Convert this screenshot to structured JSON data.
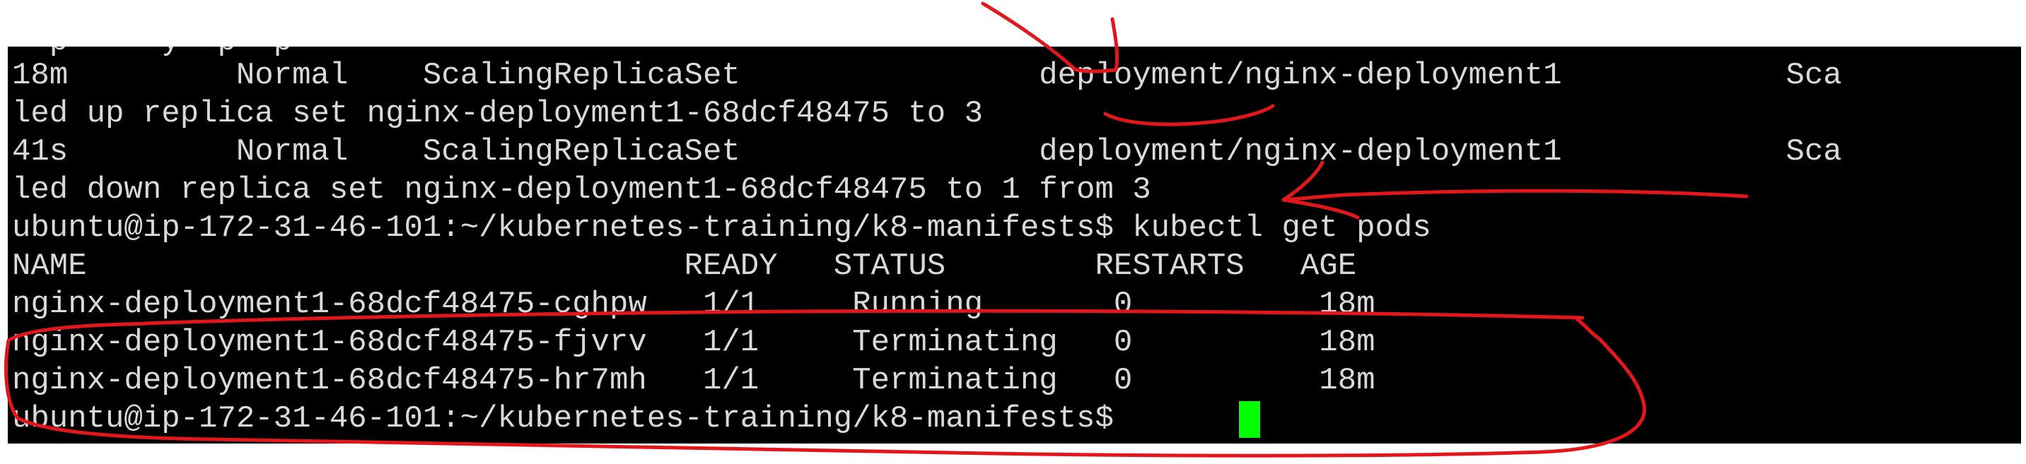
{
  "terminal": {
    "partial_top": "  p     y  p  p",
    "lines": [
      "18m         Normal    ScalingReplicaSet                deployment/nginx-deployment1            Sca",
      "led up replica set nginx-deployment1-68dcf48475 to 3",
      "41s         Normal    ScalingReplicaSet                deployment/nginx-deployment1            Sca",
      "led down replica set nginx-deployment1-68dcf48475 to 1 from 3",
      "ubuntu@ip-172-31-46-101:~/kubernetes-training/k8-manifests$ kubectl get pods",
      "NAME                                READY   STATUS        RESTARTS   AGE",
      "nginx-deployment1-68dcf48475-cghpw   1/1     Running       0          18m",
      "nginx-deployment1-68dcf48475-fjvrv   1/1     Terminating   0          18m",
      "nginx-deployment1-68dcf48475-hr7mh   1/1     Terminating   0          18m",
      "ubuntu@ip-172-31-46-101:~/kubernetes-training/k8-manifests$ "
    ],
    "cursor_color": "#00ff00",
    "text_color": "#d9d9d9",
    "background_color": "#000000"
  },
  "annotation": {
    "color": "#e3171b"
  }
}
